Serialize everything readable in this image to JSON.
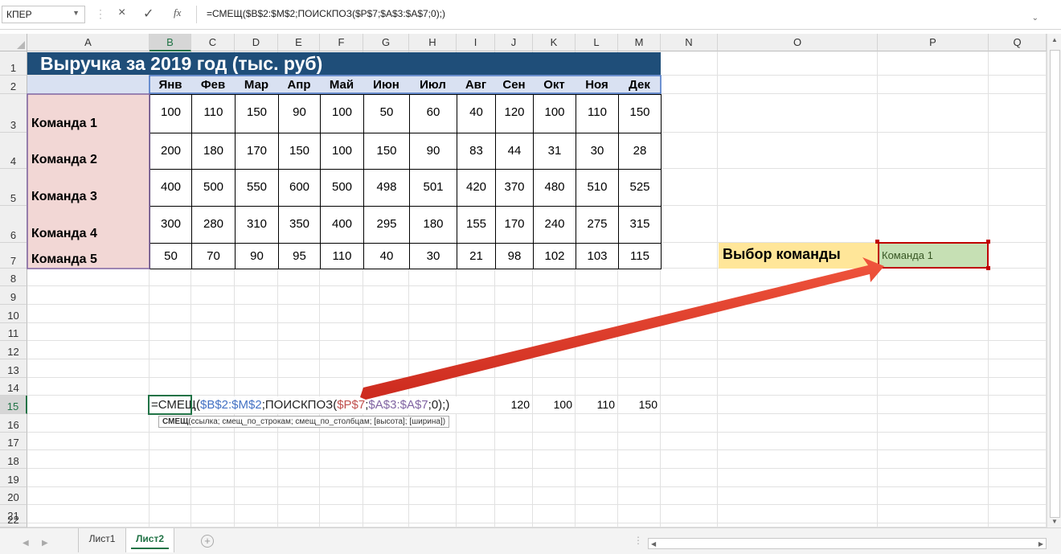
{
  "formula_bar": {
    "name_box": "КПЕР",
    "cancel_icon": "×",
    "enter_icon": "✓",
    "fx_label": "fx",
    "formula": "=СМЕЩ($B$2:$M$2;ПОИСКПОЗ($P$7;$A$3:$A$7;0);)"
  },
  "columns": [
    "A",
    "B",
    "C",
    "D",
    "E",
    "F",
    "G",
    "H",
    "I",
    "J",
    "K",
    "L",
    "M",
    "N",
    "O",
    "P",
    "Q"
  ],
  "selected_column": "B",
  "rows": [
    "1",
    "2",
    "3",
    "4",
    "5",
    "6",
    "7",
    "8",
    "9",
    "10",
    "11",
    "12",
    "13",
    "14",
    "15",
    "16",
    "17",
    "18",
    "19",
    "20",
    "21",
    "22"
  ],
  "selected_row": "15",
  "table": {
    "title": "Выручка за 2019 год (тыс. руб)",
    "months": [
      "Янв",
      "Фев",
      "Мар",
      "Апр",
      "Май",
      "Июн",
      "Июл",
      "Авг",
      "Сен",
      "Окт",
      "Ноя",
      "Дек"
    ],
    "teams": [
      {
        "name": "Команда 1",
        "values": [
          "100",
          "110",
          "150",
          "90",
          "100",
          "50",
          "60",
          "40",
          "120",
          "100",
          "110",
          "150"
        ]
      },
      {
        "name": "Команда 2",
        "values": [
          "200",
          "180",
          "170",
          "150",
          "100",
          "150",
          "90",
          "83",
          "44",
          "31",
          "30",
          "28"
        ]
      },
      {
        "name": "Команда 3",
        "values": [
          "400",
          "500",
          "550",
          "600",
          "500",
          "498",
          "501",
          "420",
          "370",
          "480",
          "510",
          "525"
        ]
      },
      {
        "name": "Команда 4",
        "values": [
          "300",
          "280",
          "310",
          "350",
          "400",
          "295",
          "180",
          "155",
          "170",
          "240",
          "275",
          "315"
        ]
      },
      {
        "name": "Команда 5",
        "values": [
          "50",
          "70",
          "90",
          "95",
          "110",
          "40",
          "30",
          "21",
          "98",
          "102",
          "103",
          "115"
        ]
      }
    ]
  },
  "selection": {
    "label": "Выбор команды",
    "value": "Команда 1"
  },
  "editing_cell": {
    "formula_parts": {
      "p1": "=СМЕЩ(",
      "p2": "$B$2:$M$2",
      "p3": ";ПОИСКПОЗ(",
      "p4": "$P$7",
      "p5": ";",
      "p6": "$A$3:$A$7",
      "p7": ";0);)"
    },
    "spill_values": [
      "120",
      "100",
      "110",
      "150"
    ],
    "tooltip_func": "СМЕЩ",
    "tooltip_args": "(ссылка; смещ_по_строкам; смещ_по_столбцам; [высота]; [ширина])"
  },
  "sheets": [
    "Лист1",
    "Лист2"
  ],
  "active_sheet": "Лист2",
  "colors": {
    "title_bg": "#1f4e79",
    "header_bg": "#d9e1f2",
    "team_bg": "#f2d7d5",
    "label_bg": "#ffe699",
    "result_bg": "#c6e0b4",
    "arrow": "#e8342a",
    "ref_blue": "#4472c4",
    "ref_red": "#c0504d",
    "ref_purple": "#8064a2"
  }
}
